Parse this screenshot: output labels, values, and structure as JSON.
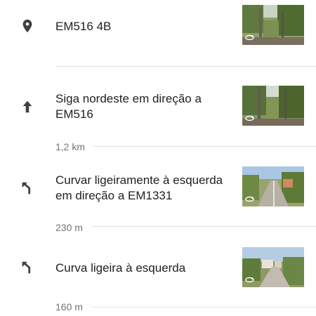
{
  "steps": [
    {
      "icon": "location-pin-icon",
      "text": "EM516 4B",
      "thumbnail": "street-view-trees-photo"
    },
    {
      "icon": "arrow-up-icon",
      "text": "Siga nordeste em direção a EM516",
      "thumbnail": "street-view-trees-photo",
      "distance": "1,2 km"
    },
    {
      "icon": "slight-left-icon",
      "text": "Curvar ligeiramente à esquerda em direção a EM1331",
      "thumbnail": "street-view-road-photo",
      "distance": "230 m"
    },
    {
      "icon": "slight-left-icon",
      "text": "Curva ligeira à esquerda",
      "thumbnail": "street-view-road-houses-photo",
      "distance": "160 m"
    }
  ],
  "colors": {
    "text": "#202124",
    "secondary_text": "#70757a",
    "icon": "#3c4043",
    "divider": "#e3e3e3"
  }
}
